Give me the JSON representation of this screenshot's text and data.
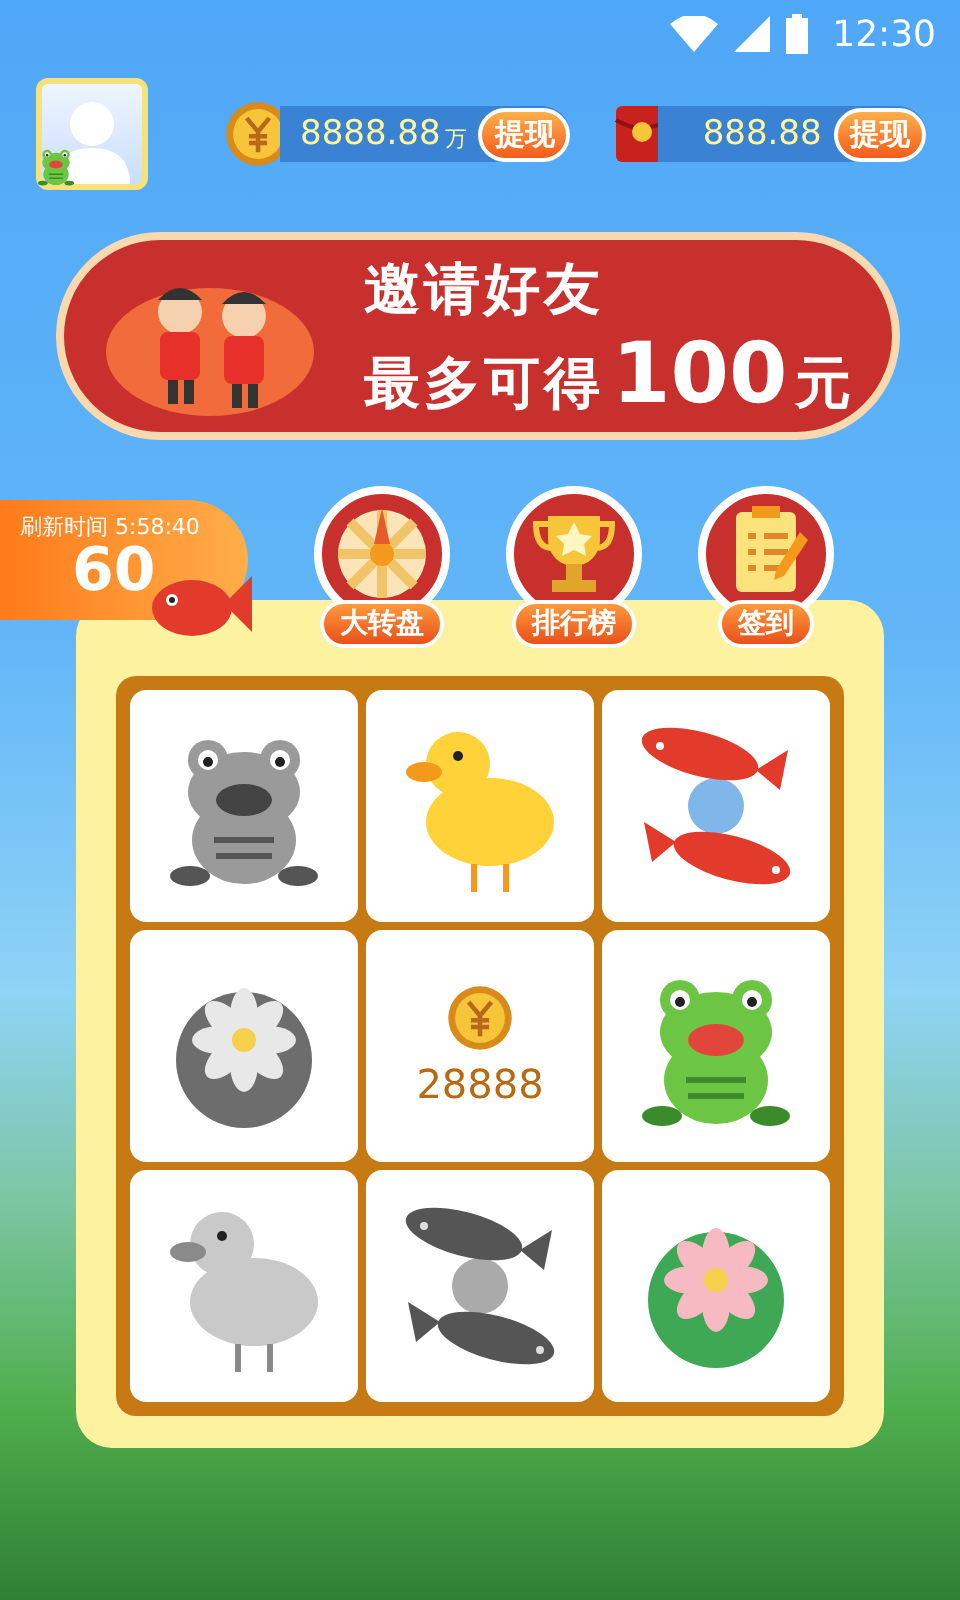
{
  "status_bar": {
    "time": "12:30"
  },
  "balances": [
    {
      "kind": "coin",
      "amount": "8888.88",
      "unit": "万",
      "action": "提现"
    },
    {
      "kind": "envelope",
      "amount": "888.88",
      "action": "提现"
    }
  ],
  "banner": {
    "line_1": "邀请好友",
    "line_2": "最多可得",
    "amount": "100",
    "unit": "元"
  },
  "timer": {
    "label": "刷新时间 5:58:40",
    "count": "60"
  },
  "shortcuts": [
    {
      "kind": "wheel",
      "label": "大转盘"
    },
    {
      "kind": "trophy",
      "label": "排行榜"
    },
    {
      "kind": "checklist",
      "label": "签到"
    }
  ],
  "grid": [
    {
      "kind": "frog",
      "collected": false
    },
    {
      "kind": "duck",
      "collected": true
    },
    {
      "kind": "koi",
      "collected": true
    },
    {
      "kind": "lotus",
      "collected": false
    },
    {
      "kind": "coin",
      "prize": "28888"
    },
    {
      "kind": "frog",
      "collected": true
    },
    {
      "kind": "duck",
      "collected": false
    },
    {
      "kind": "koi",
      "collected": false
    },
    {
      "kind": "lotus",
      "collected": true
    }
  ]
}
